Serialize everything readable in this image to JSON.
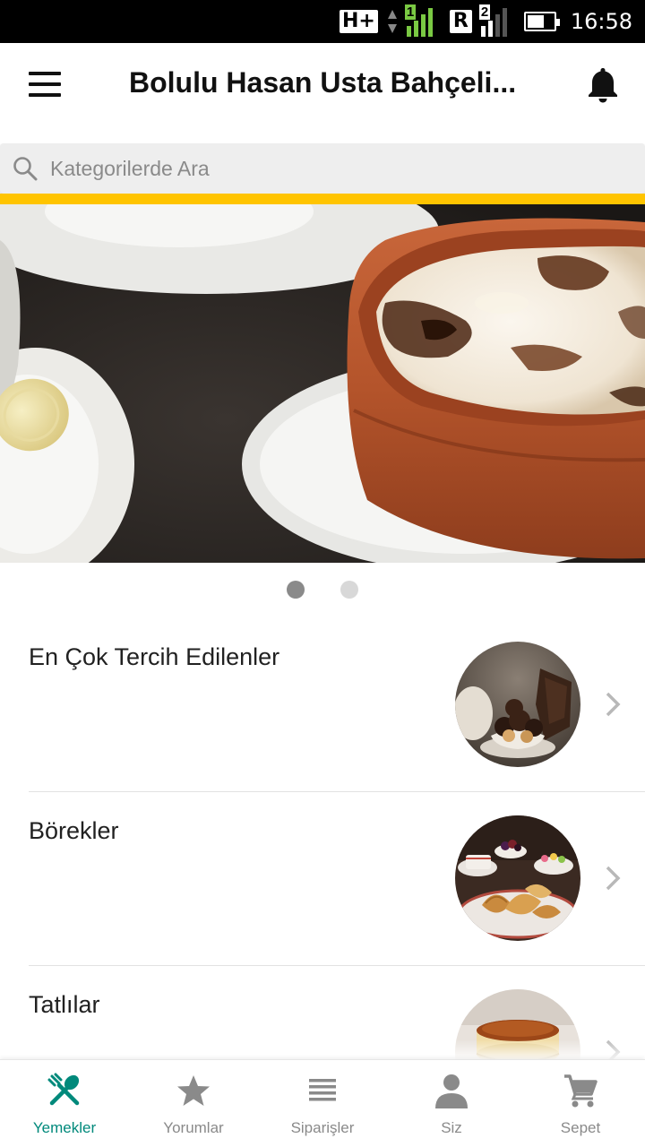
{
  "status_bar": {
    "network": "H+",
    "sim1": "1",
    "roaming": "R",
    "sim2": "2",
    "time": "16:58"
  },
  "app_bar": {
    "title": "Bolulu Hasan Usta Bahçeli...",
    "menu_icon": "hamburger-menu-icon",
    "notification_icon": "bell-icon"
  },
  "search": {
    "placeholder": "Kategorilerde Ara",
    "icon": "search-icon"
  },
  "colors": {
    "accent": "#ffc400",
    "nav_active": "#00897b",
    "nav_inactive": "#8a8a8a"
  },
  "carousel": {
    "slides": 2,
    "active_index": 0,
    "image": "rice-pudding-clay-pot-photo"
  },
  "categories": [
    {
      "label": "En Çok Tercih Edilenler",
      "image": "profiterole-dessert-photo"
    },
    {
      "label": "Börekler",
      "image": "croissant-breakfast-photo"
    },
    {
      "label": "Tatlılar",
      "image": "cheesecake-photo"
    }
  ],
  "bottom_nav": {
    "active": "Yemekler",
    "items": [
      {
        "label": "Yemekler",
        "icon": "fork-spoon-icon"
      },
      {
        "label": "Yorumlar",
        "icon": "star-icon"
      },
      {
        "label": "Siparişler",
        "icon": "list-icon"
      },
      {
        "label": "Siz",
        "icon": "person-icon"
      },
      {
        "label": "Sepet",
        "icon": "cart-icon"
      }
    ]
  }
}
